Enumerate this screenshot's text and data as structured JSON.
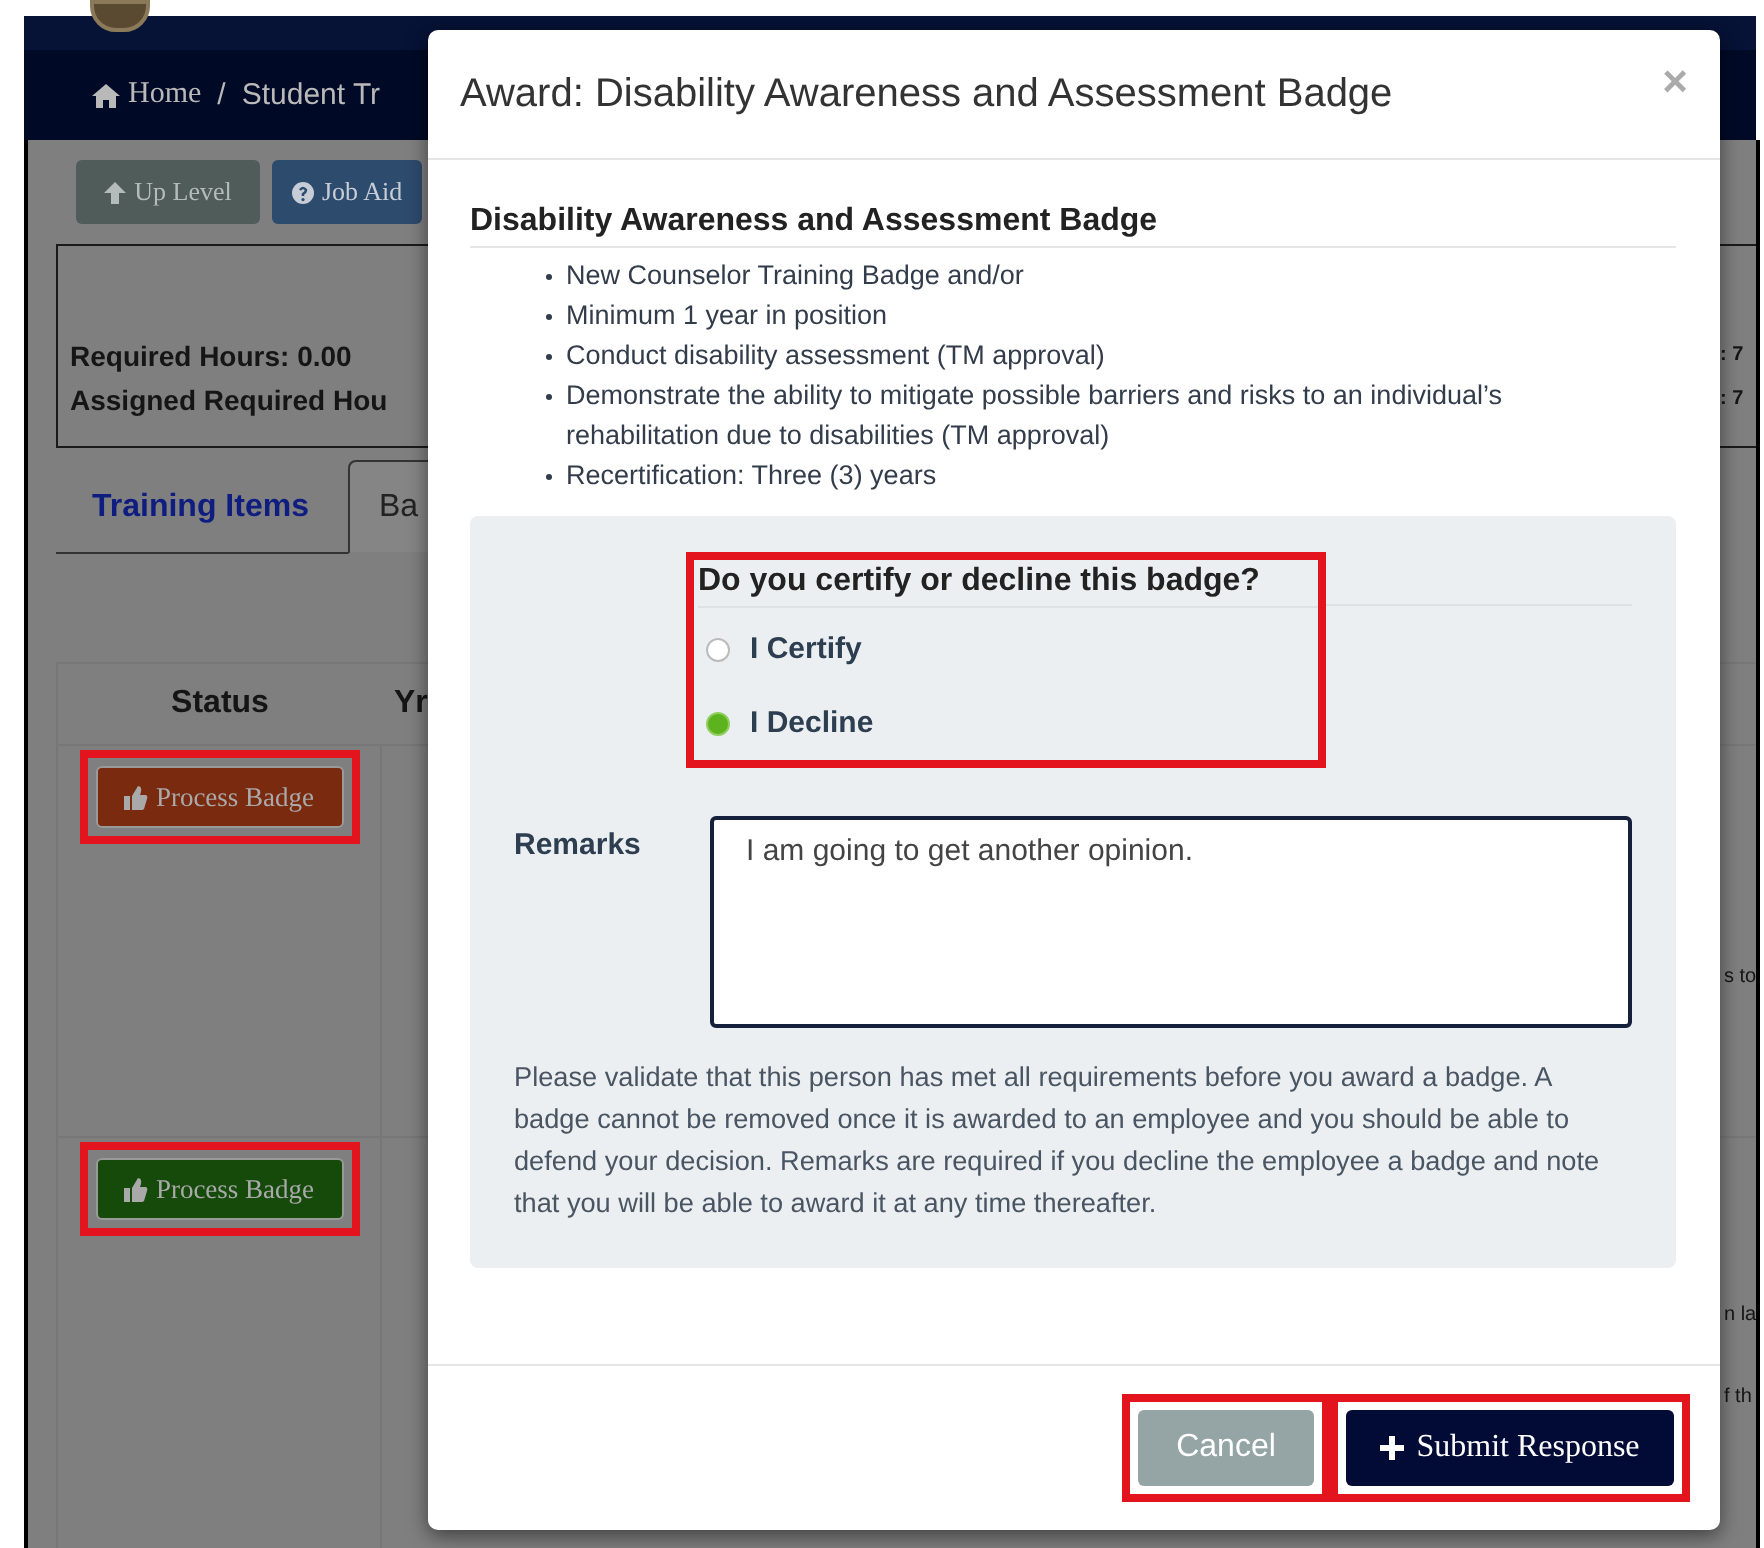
{
  "breadcrumb": {
    "items": [
      {
        "label": "Home",
        "kind": "home"
      },
      {
        "label": "Student Tr",
        "kind": "plain"
      }
    ],
    "separator": "/"
  },
  "toolbar": [
    {
      "label": "Up Level",
      "kind": "up"
    },
    {
      "label": "Job Aid",
      "kind": "help"
    }
  ],
  "summary": [
    {
      "text": "Required Hours: 0.00",
      "edge": ": 7"
    },
    {
      "text": "Assigned Required Hou",
      "edge": ": 7"
    }
  ],
  "tabs": [
    {
      "label": "Training Items",
      "selected": false
    },
    {
      "label": "Ba",
      "selected": true
    }
  ],
  "table": {
    "columns": [
      "Status",
      "Yr"
    ],
    "rows": [
      {
        "button": {
          "label": "Process Badge",
          "kind": "danger",
          "highlighted": true
        },
        "edge_texts": [
          "s to"
        ]
      },
      {
        "button": {
          "label": "Process Badge",
          "kind": "success",
          "highlighted": true
        },
        "edge_texts": [
          "n la",
          "f th"
        ]
      }
    ]
  },
  "modal": {
    "title": "Award: Disability Awareness and Assessment Badge",
    "close": "×",
    "heading": "Disability Awareness and Assessment Badge",
    "requirements": [
      "New Counselor Training Badge and/or",
      "Minimum 1 year in position",
      "Conduct disability assessment (TM approval)",
      "Demonstrate the ability to mitigate possible barriers and risks to an individual’s rehabilitation due to disabilities (TM approval)",
      "Recertification: Three (3) years"
    ],
    "question": {
      "text": "Do you certify or decline this badge?",
      "highlighted": true,
      "options": [
        {
          "label": "I Certify",
          "selected": false
        },
        {
          "label": "I Decline",
          "selected": true
        }
      ]
    },
    "remarks": {
      "label": "Remarks",
      "value": "I am going to get another opinion."
    },
    "notice": "Please validate that this person has met all requirements before you award a badge. A badge cannot be removed once it is awarded to an employee and you should be able to defend your decision. Remarks are required if you decline the employee a badge and note that you will be able to award it at any time thereafter.",
    "buttons": [
      {
        "label": "Cancel",
        "kind": "cancel",
        "highlighted": true
      },
      {
        "label": "Submit Response",
        "kind": "submit",
        "highlighted": true
      }
    ]
  }
}
